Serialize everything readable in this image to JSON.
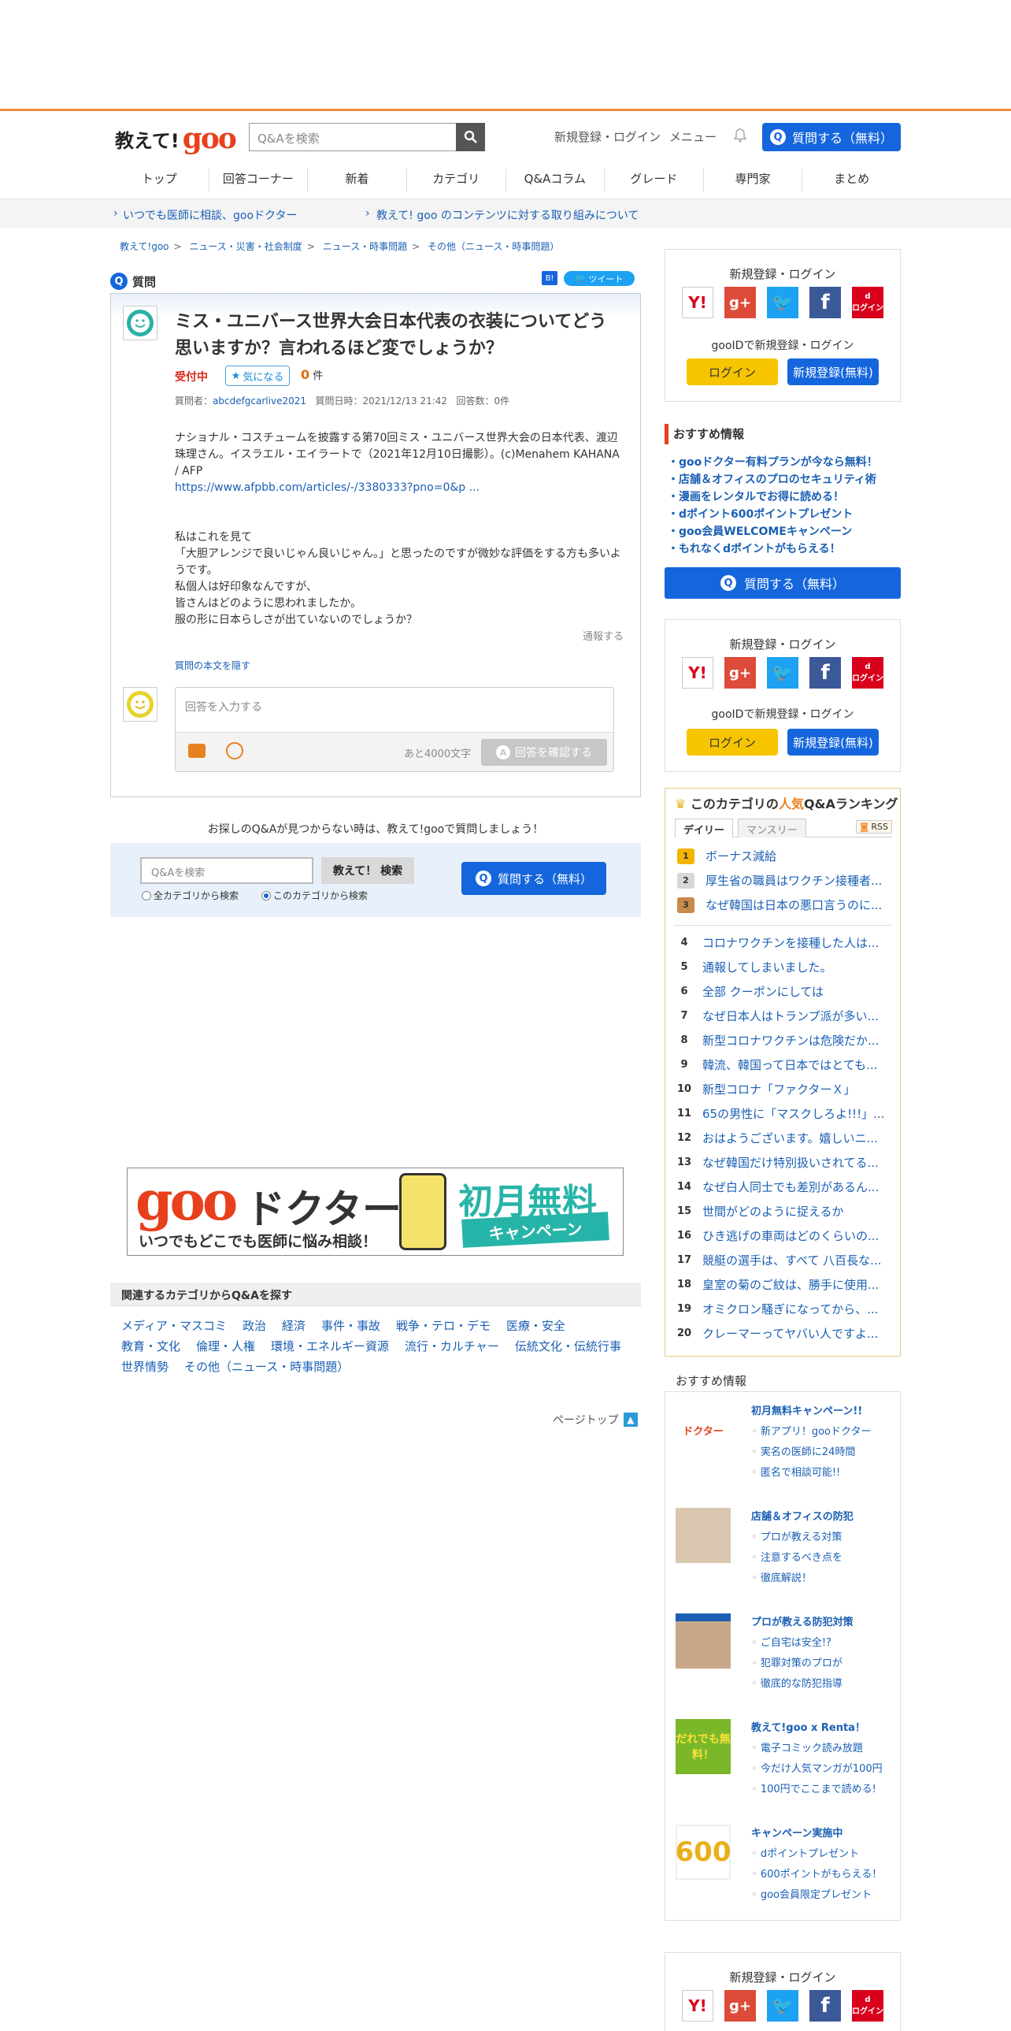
{
  "header": {
    "logo_text": "教えて!",
    "logo_brand": "goo",
    "search_placeholder": "Q&Aを検索",
    "signup_login": "新規登録・ログイン",
    "menu": "メニュー",
    "ask_button": "質問する（無料）"
  },
  "nav": [
    "トップ",
    "回答コーナー",
    "新着",
    "カテゴリ",
    "Q&Aコラム",
    "グレード",
    "専門家",
    "まとめ"
  ],
  "subbar": {
    "link1": "いつでも医師に相談、gooドクター",
    "link2": "教えて! goo のコンテンツに対する取り組みについて"
  },
  "breadcrumb": [
    "教えて!goo",
    "ニュース・災害・社会制度",
    "ニュース・時事問題",
    "その他（ニュース・時事問題）"
  ],
  "question": {
    "section_label": "質問",
    "tweet_label": "ツイート",
    "title": "ミス・ユニバース世界大会日本代表の衣装についてどう思いますか？言われるほど変でしょうか？",
    "status": "受付中",
    "kininaru": "気になる",
    "count": "0",
    "count_unit": "件",
    "asker_label": "質問者：",
    "asker": "abcdefgcarlive2021",
    "date": "質問日時：2021/12/13 21:42",
    "answers": "回答数：0件",
    "body_lines": [
      "ナショナル・コスチュームを披露する第70回ミス・ユニバース世界大会の日本代表、渡辺珠理さん。イスラエル・エイラートで（2021年12月10日撮影）。(c)Menahem KAHANA / AFP",
      "https://www.afpbb.com/articles/-/3380333?pno=0&p ...",
      "",
      "私はこれを見て",
      "「大胆アレンジで良いじゃん良いじゃん。」と思ったのですが微妙な評価をする方も多いようです。",
      "私個人は好印象なんですが、",
      "皆さんはどのように思われましたか。",
      "服の形に日本らしさが出ていないのでしょうか？"
    ],
    "report": "通報する",
    "hide_body": "質問の本文を隠す",
    "answer_placeholder": "回答を入力する",
    "remaining": "あと4000文字",
    "confirm_button": "回答を確認する"
  },
  "search_section": {
    "notfound": "お探しのQ&Aが見つからない時は、教えて!gooで質問しましょう！",
    "placeholder": "Q&Aを検索",
    "button": "教えて！ 検索",
    "radio_all": "全カテゴリから検索",
    "radio_this": "このカテゴリから検索",
    "ask_button": "質問する（無料）"
  },
  "banner": {
    "brand": "goo",
    "doctor": "ドクター",
    "sub": "いつでもどこでも医師に悩み相談！",
    "free": "初月無料",
    "campaign": "キャンペーン"
  },
  "related": {
    "heading": "関連するカテゴリからQ&Aを探す",
    "row1": [
      "メディア・マスコミ",
      "政治",
      "経済",
      "事件・事故",
      "戦争・テロ・デモ",
      "医療・安全"
    ],
    "row2": [
      "教育・文化",
      "倫理・人権",
      "環境・エネルギー資源",
      "流行・カルチャー",
      "伝統文化・伝統行事"
    ],
    "row3": [
      "世界情勢",
      "その他（ニュース・時事問題）"
    ]
  },
  "pagetop": "ページトップ",
  "sidebar": {
    "login_heading": "新規登録・ログイン",
    "gooid_heading": "gooIDで新規登録・ログイン",
    "login_button": "ログイン",
    "signup_button": "新規登録(無料)",
    "sns_docomo_label": "ログイン",
    "reco_heading": "おすすめ情報",
    "reco_items": [
      "・gooドクター有料プランが今なら無料！",
      "・店舗＆オフィスのプロのセキュリティ術",
      "・漫画をレンタルでお得に読める！",
      "・dポイント600ポイントプレゼント",
      "・goo会員WELCOMEキャンペーン",
      "・もれなくdポイントがもらえる！"
    ],
    "ask_button": "質問する（無料）",
    "ranking": {
      "title_pre": "このカテゴリの",
      "title_hl": "人気",
      "title_post": "Q&Aランキング",
      "tab_daily": "デイリー",
      "tab_monthly": "マンスリー",
      "rss": "RSS",
      "items": [
        "ボーナス減給",
        "厚生省の職員はワクチン接種者...",
        "なぜ韓国は日本の悪口言うのに...",
        "コロナワクチンを接種した人は...",
        "通報してしまいました。",
        "全部 クーポンにしては",
        "なぜ日本人はトランプ派が多い...",
        "新型コロナワクチンは危険だか...",
        "韓流、韓国って日本ではとても...",
        "新型コロナ「ファクターＸ」",
        "65の男性に「マスクしろよ!!!」...",
        "おはようございます。嬉しいニ...",
        "なぜ韓国だけ特別扱いされてる...",
        "なぜ白人同士でも差別があるん...",
        "世間がどのように捉えるか",
        "ひき逃げの車両はどのくらいの...",
        "競艇の選手は、すべて 八百長な...",
        "皇室の菊のご紋は、勝手に使用...",
        "オミクロン騒ぎになってから、...",
        "クレーマーってヤバい人ですよ..."
      ]
    },
    "osusume_heading": "おすすめ情報",
    "osusume": [
      {
        "title": "初月無料キャンペーン!!",
        "img": "ドクター",
        "links": [
          "新アプリ！gooドクター",
          "実名の医師に24時間",
          "匿名で相談可能!!"
        ]
      },
      {
        "title": "店舗＆オフィスの防犯",
        "img": "",
        "links": [
          "プロが教える対策",
          "注意するべき点を",
          "徹底解説！"
        ]
      },
      {
        "title": "プロが教える防犯対策",
        "img": "",
        "links": [
          "ご自宅は安全!?",
          "犯罪対策のプロが",
          "徹底的な防犯指導"
        ]
      },
      {
        "title": "教えて!goo x Renta！",
        "img": "だれでも無料！",
        "links": [
          "電子コミック読み放題",
          "今だけ人気マンガが100円",
          "100円でここまで読める!"
        ]
      },
      {
        "title": "キャンペーン実施中",
        "img": "600",
        "links": [
          "dポイントプレゼント",
          "600ポイントがもらえる！",
          "goo会員限定プレゼント"
        ]
      }
    ]
  },
  "colors": {
    "accent_orange": "#f08e3c",
    "brand_red": "#e8401c",
    "primary_blue": "#1566dd",
    "link_blue": "#1a5fb4"
  }
}
